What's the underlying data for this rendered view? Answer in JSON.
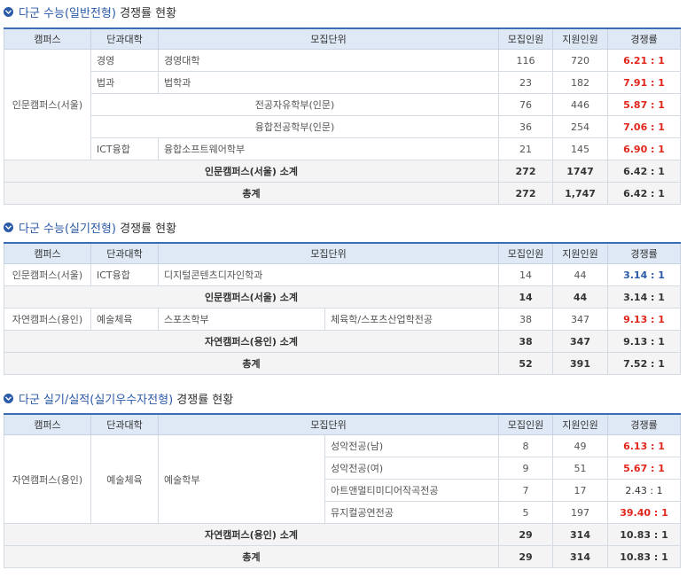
{
  "sections": [
    {
      "title_blue": "다군 수능(일반전형)",
      "title_rest": "경쟁률 현황",
      "headers": [
        "캠퍼스",
        "단과대학",
        "모집단위",
        "모집인원",
        "지원인원",
        "경쟁률"
      ],
      "campus": "인문캠퍼스(서울)",
      "rows": [
        {
          "college": "경영",
          "unit": "경영대학",
          "quota": "116",
          "applicants": "720",
          "ratio": "6.21 : 1"
        },
        {
          "college": "법과",
          "unit": "법학과",
          "quota": "23",
          "applicants": "182",
          "ratio": "7.91 : 1"
        },
        {
          "college": "",
          "unit": "전공자유학부(인문)",
          "quota": "76",
          "applicants": "446",
          "ratio": "5.87 : 1"
        },
        {
          "college": "",
          "unit": "융합전공학부(인문)",
          "quota": "36",
          "applicants": "254",
          "ratio": "7.06 : 1"
        },
        {
          "college": "ICT융합",
          "unit": "융합소프트웨어학부",
          "quota": "21",
          "applicants": "145",
          "ratio": "6.90 : 1"
        }
      ],
      "subtotals": [
        {
          "label": "인문캠퍼스(서울) 소계",
          "quota": "272",
          "applicants": "1747",
          "ratio": "6.42 : 1"
        }
      ],
      "total": {
        "label": "총계",
        "quota": "272",
        "applicants": "1,747",
        "ratio": "6.42 : 1"
      }
    },
    {
      "title_blue": "다군 수능(실기전형)",
      "title_rest": "경쟁률 현황",
      "headers": [
        "캠퍼스",
        "단과대학",
        "모집단위",
        "모집인원",
        "지원인원",
        "경쟁률"
      ],
      "rows": [
        {
          "campus": "인문캠퍼스(서울)",
          "college": "ICT융합",
          "unit": "디지털콘텐츠디자인학과",
          "quota": "14",
          "applicants": "44",
          "ratio": "3.14 : 1"
        },
        {
          "campus": "자연캠퍼스(용인)",
          "college": "예술체육",
          "unit": "스포츠학부",
          "major": "체육학/스포츠산업학전공",
          "quota": "38",
          "applicants": "347",
          "ratio": "9.13 : 1"
        }
      ],
      "subtotals": [
        {
          "label": "인문캠퍼스(서울) 소계",
          "quota": "14",
          "applicants": "44",
          "ratio": "3.14 : 1"
        },
        {
          "label": "자연캠퍼스(용인) 소계",
          "quota": "38",
          "applicants": "347",
          "ratio": "9.13 : 1"
        }
      ],
      "total": {
        "label": "총계",
        "quota": "52",
        "applicants": "391",
        "ratio": "7.52 : 1"
      }
    },
    {
      "title_blue": "다군 실기/실적(실기우수자전형)",
      "title_rest": "경쟁률 현황",
      "headers": [
        "캠퍼스",
        "단과대학",
        "모집단위",
        "모집인원",
        "지원인원",
        "경쟁률"
      ],
      "campus": "자연캠퍼스(용인)",
      "college": "예술체육",
      "unit": "예술학부",
      "rows": [
        {
          "major": "성악전공(남)",
          "quota": "8",
          "applicants": "49",
          "ratio": "6.13 : 1"
        },
        {
          "major": "성악전공(여)",
          "quota": "9",
          "applicants": "51",
          "ratio": "5.67 : 1"
        },
        {
          "major": "아트앤멀티미디어작곡전공",
          "quota": "7",
          "applicants": "17",
          "ratio": "2.43 : 1"
        },
        {
          "major": "뮤지컬공연전공",
          "quota": "5",
          "applicants": "197",
          "ratio": "39.40 : 1"
        }
      ],
      "subtotals": [
        {
          "label": "자연캠퍼스(용인) 소계",
          "quota": "29",
          "applicants": "314",
          "ratio": "10.83 : 1"
        }
      ],
      "total": {
        "label": "총계",
        "quota": "29",
        "applicants": "314",
        "ratio": "10.83 : 1"
      }
    }
  ],
  "colors": {
    "accent": "#2b5aa8",
    "ratio_high": "#e1261c",
    "ratio_low": "#2b5aa8",
    "header_bg": "#dfe9f6"
  }
}
